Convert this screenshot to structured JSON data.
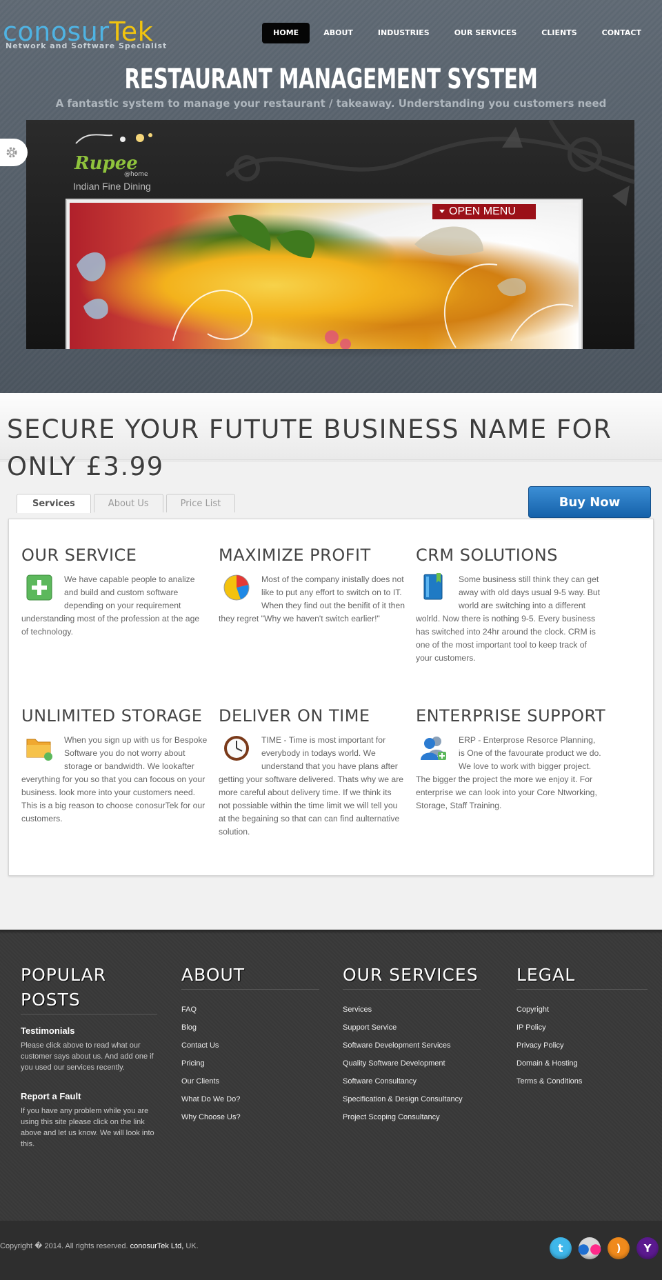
{
  "brand": {
    "name_part1": "conosur",
    "name_part2": "Tek",
    "tagline": "Network and Software Specialist"
  },
  "nav": {
    "items": [
      "HOME",
      "ABOUT",
      "INDUSTRIES",
      "OUR SERVICES",
      "CLIENTS",
      "CONTACT"
    ],
    "active": "HOME"
  },
  "hero": {
    "title": "RESTAURANT MANAGEMENT SYSTEM",
    "subtitle": "A fantastic system to manage your restaurant / takeaway. Understanding you customers need"
  },
  "slider": {
    "restaurant_logo": "Rupee",
    "logo_suffix": "@home",
    "restaurant_caption": "Indian Fine Dining",
    "open_menu_label": "OPEN MENU"
  },
  "promo": {
    "title": "SECURE YOUR FUTUTE BUSINESS NAME FOR ONLY £3.99"
  },
  "tabs": {
    "items": [
      "Services",
      "About Us",
      "Price List"
    ],
    "active": "Services"
  },
  "buy_button": "Buy Now",
  "services": [
    {
      "title": "OUR SERVICE",
      "icon": "plus-box-icon",
      "text": "We have capable people to analize and build and custom software depending on your requirement understanding most of the profession at the age of technology."
    },
    {
      "title": "MAXIMIZE PROFIT",
      "icon": "pie-chart-icon",
      "text": "Most of the company inistally does not like to put any effort to switch on to IT. When they find out the benifit of it then they regret \"Why we haven't switch earlier!\""
    },
    {
      "title": "CRM SOLUTIONS",
      "icon": "book-icon",
      "text": "Some business still think they can get away with old days usual 9-5 way. But world are switching into a different wolrld. Now there is nothing 9-5. Every business has switched into 24hr around the clock. CRM is one of the most important tool to keep track of your customers."
    },
    {
      "title": "UNLIMITED STORAGE",
      "icon": "folder-icon",
      "text": "When you sign up with us for Bespoke Software you do not worry about storage or bandwidth. We lookafter everything for you so that you can focous on your business. look more into your customers need. This is a big reason to choose conosurTek for our customers."
    },
    {
      "title": "DELIVER ON TIME",
      "icon": "clock-icon",
      "text": "TIME - Time is most important for everybody in todays world. We understand that you have plans after getting your software delivered. Thats why we are more careful about delivery time. If we think its not possiable within the time limit we will tell you at the begaining so that can can find aulternative solution."
    },
    {
      "title": "ENTERPRISE SUPPORT",
      "icon": "users-add-icon",
      "text": "ERP - Enterprose Resorce Planning, is One of the favourate product we do. We love to work with bigger project. The bigger the project the more we enjoy it. For enterprise we can look into your Core Ntworking, Storage, Staff Training."
    }
  ],
  "footer": {
    "popular": {
      "heading": "POPULAR POSTS",
      "posts": [
        {
          "title": "Testimonials",
          "text": "Please click above to read what our customer says about us. And add one if you used our services recently."
        },
        {
          "title": "Report a Fault",
          "text": "If you have any problem while you are using this site please click on the link above and let us know. We will look into this."
        }
      ]
    },
    "about": {
      "heading": "ABOUT",
      "links": [
        "FAQ",
        "Blog",
        "Contact Us",
        "Pricing",
        "Our Clients",
        "What Do We Do?",
        "Why Choose Us?"
      ]
    },
    "services": {
      "heading": "OUR SERVICES",
      "links": [
        "Services",
        "Support Service",
        "Software Development Services",
        "Quality Software Development",
        "Software Consultancy",
        "Specification & Design Consultancy",
        "Project Scoping Consultancy"
      ]
    },
    "legal": {
      "heading": "LEGAL",
      "links": [
        "Copyright",
        "IP Policy",
        "Privacy Policy",
        "Domain & Hosting",
        "Terms & Conditions"
      ]
    }
  },
  "copyright": {
    "prefix": "Copyright � 2014. All rights reserved.",
    "company": "conosurTek Ltd,",
    "suffix": "UK."
  },
  "social": [
    {
      "name": "twitter-icon",
      "glyph": "t",
      "color": "#3fb7ea"
    },
    {
      "name": "flickr-icon",
      "glyph": "••",
      "color": "#d9d9d9"
    },
    {
      "name": "rss-icon",
      "glyph": ")",
      "color": "#f08a1c"
    },
    {
      "name": "yahoo-icon",
      "glyph": "Y",
      "color": "#5b1a8f"
    }
  ]
}
